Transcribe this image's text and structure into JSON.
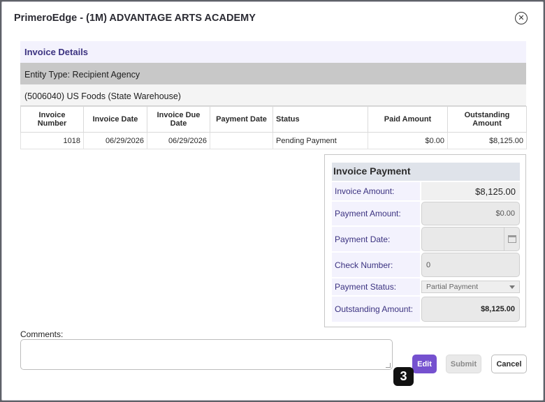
{
  "modal": {
    "title": "PrimeroEdge - (1M) ADVANTAGE ARTS ACADEMY",
    "close_icon": "x-circle-icon"
  },
  "invoice_details": {
    "section_title": "Invoice Details",
    "entity_type": "Entity Type: Recipient Agency",
    "vendor": "(5006040) US Foods (State Warehouse)",
    "columns": [
      "Invoice Number",
      "Invoice Date",
      "Invoice Due Date",
      "Payment Date",
      "Status",
      "Paid Amount",
      "Outstanding Amount"
    ],
    "rows": [
      {
        "invoice_number": "1018",
        "invoice_date": "06/29/2026",
        "due_date": "06/29/2026",
        "payment_date": "",
        "status": "Pending Payment",
        "paid_amount": "$0.00",
        "outstanding_amount": "$8,125.00"
      }
    ]
  },
  "invoice_payment": {
    "title": "Invoice Payment",
    "invoice_amount_label": "Invoice Amount:",
    "invoice_amount": "$8,125.00",
    "payment_amount_label": "Payment Amount:",
    "payment_amount": "$0.00",
    "payment_date_label": "Payment Date:",
    "payment_date": "",
    "check_number_label": "Check Number:",
    "check_number": "0",
    "payment_status_label": "Payment Status:",
    "payment_status": "Partial Payment",
    "outstanding_amount_label": "Outstanding Amount:",
    "outstanding_amount": "$8,125.00"
  },
  "comments": {
    "label": "Comments:",
    "value": ""
  },
  "buttons": {
    "edit": "Edit",
    "submit": "Submit",
    "cancel": "Cancel"
  },
  "step_badge": "3",
  "colors": {
    "accent": "#7551cf",
    "label_text": "#3b3280",
    "header_bg": "#f3f2fd"
  }
}
